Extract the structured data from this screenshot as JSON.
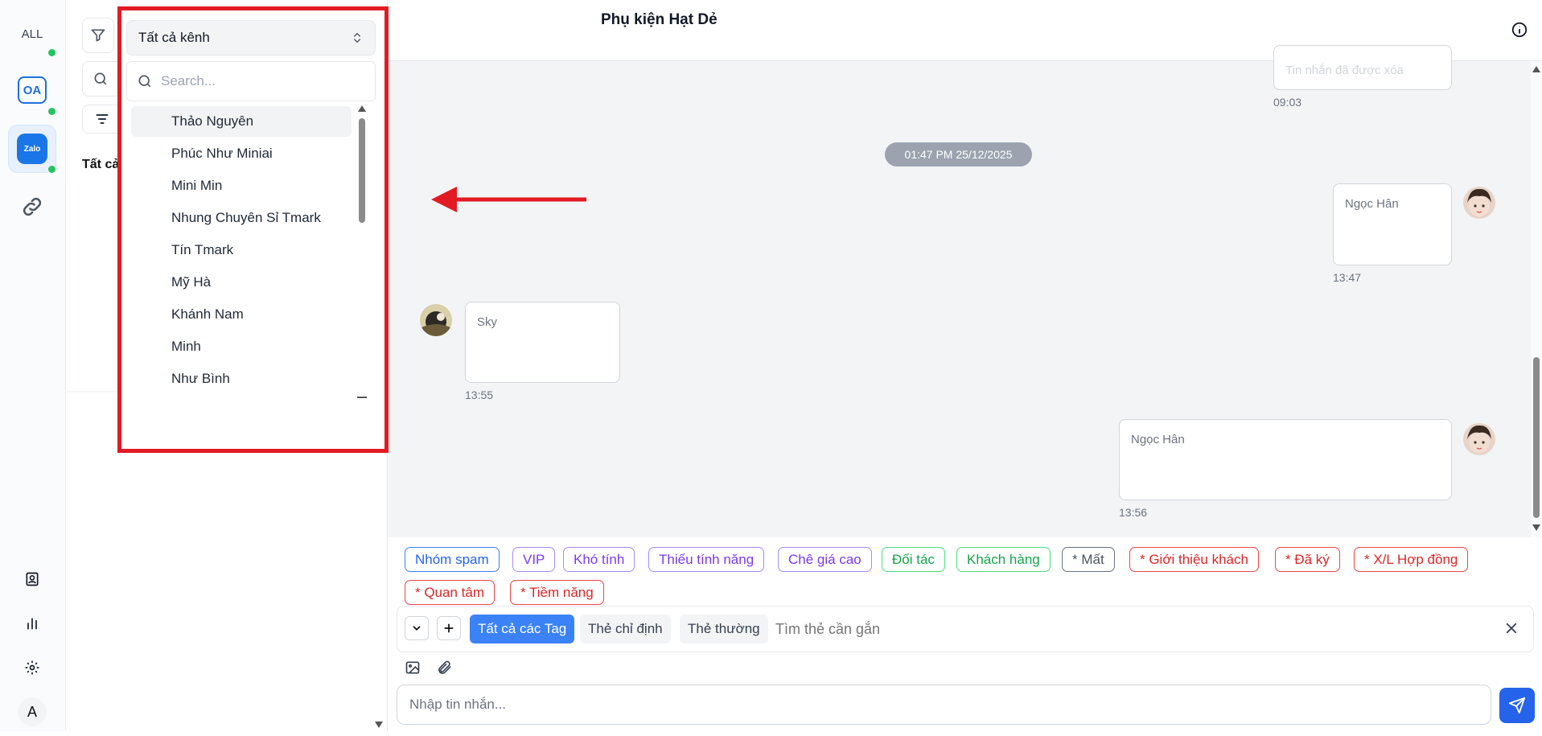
{
  "rail": {
    "all_label": "ALL",
    "oa_label": "OA",
    "zalo_label": "Zalo",
    "user_initial": "A"
  },
  "convcol": {
    "partial_tab_label": "Tất cả"
  },
  "dropdown": {
    "selected_label": "Tất cả kênh",
    "search_placeholder": "Search...",
    "options": [
      "Thảo Nguyên",
      "Phúc Như Miniai",
      "Mini Min",
      "Nhung Chuyên Sỉ Tmark",
      "Tín Tmark",
      "Mỹ Hà",
      "Khánh Nam",
      "Minh",
      "Như Bình"
    ],
    "highlight_color": "#e21b23"
  },
  "header": {
    "title": "Phụ kiện Hạt Dẻ"
  },
  "chat": {
    "deleted_message": "Tin nhắn đã được xóa",
    "deleted_time": "09:03",
    "date_separator": "01:47 PM 25/12/2025",
    "messages": [
      {
        "sender": "Ngọc Hân",
        "time": "13:47"
      },
      {
        "sender": "Sky",
        "time": "13:55"
      },
      {
        "sender": "Ngọc Hân",
        "time": "13:56"
      }
    ]
  },
  "tags": [
    {
      "label": "Nhóm spam",
      "color": "blue"
    },
    {
      "label": "VIP",
      "color": "violet"
    },
    {
      "label": "Khó tính",
      "color": "violet"
    },
    {
      "label": "Thiếu tính năng",
      "color": "violet"
    },
    {
      "label": "Chê giá cao",
      "color": "violet"
    },
    {
      "label": "Đối tác",
      "color": "green"
    },
    {
      "label": "Khách hàng",
      "color": "green"
    },
    {
      "label": "* Mất",
      "color": "gray"
    },
    {
      "label": "* Giới thiệu khách",
      "color": "red"
    },
    {
      "label": "* Đã ký",
      "color": "red"
    },
    {
      "label": "* X/L Hợp đồng",
      "color": "red"
    },
    {
      "label": "* Quan tâm",
      "color": "red"
    },
    {
      "label": "* Tiềm năng",
      "color": "red"
    }
  ],
  "tagbar": {
    "all_tags": "Tất cả các Tag",
    "designated_tags": "Thẻ chỉ định",
    "normal_tags": "Thẻ thường",
    "search_placeholder": "Tìm thẻ cần gắn"
  },
  "composer": {
    "placeholder": "Nhập tin nhắn..."
  },
  "colors": {
    "accent": "#2563eb",
    "chat_bg": "#f3f4f6"
  }
}
